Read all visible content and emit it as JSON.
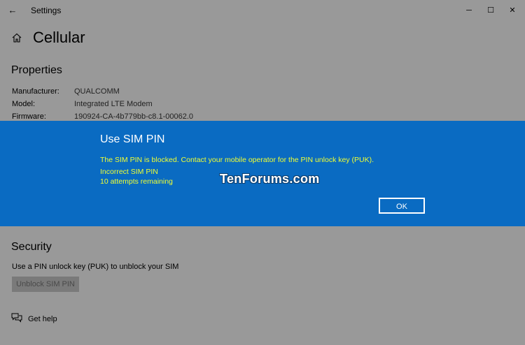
{
  "window": {
    "app_title": "Settings",
    "back_glyph": "←",
    "min_glyph": "─",
    "max_glyph": "☐",
    "close_glyph": "✕"
  },
  "page": {
    "title": "Cellular"
  },
  "properties": {
    "heading": "Properties",
    "rows": [
      {
        "label": "Manufacturer:",
        "value": "QUALCOMM"
      },
      {
        "label": "Model:",
        "value": "Integrated LTE Modem"
      },
      {
        "label": "Firmware:",
        "value": "190924-CA-4b779bb-c8.1-00062.0"
      }
    ]
  },
  "security": {
    "heading": "Security",
    "description": "Use a PIN unlock key (PUK) to unblock your SIM",
    "button_label": "Unblock SIM PIN"
  },
  "help": {
    "label": "Get help"
  },
  "dialog": {
    "title": "Use SIM PIN",
    "message": "The SIM PIN is blocked. Contact your mobile operator for the PIN unlock key (PUK).",
    "status_line1": "Incorrect SIM PIN",
    "status_line2": "10 attempts remaining",
    "ok_label": "OK",
    "watermark": "TenForums.com",
    "background_color": "#0a6bc2",
    "message_color": "#f0ff33"
  }
}
